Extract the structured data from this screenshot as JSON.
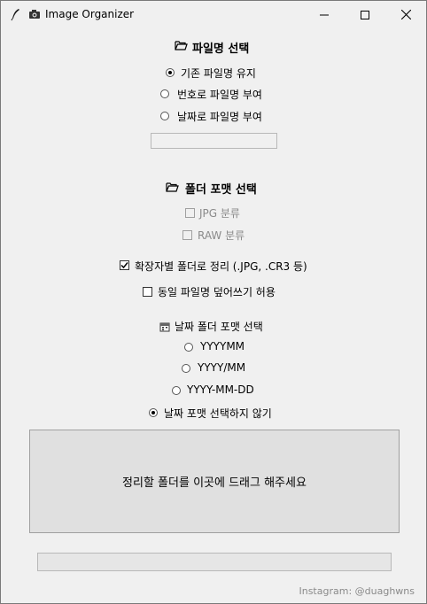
{
  "window": {
    "title": "Image Organizer",
    "icon": "feather-icon",
    "camera_icon": "camera-icon",
    "controls": [
      "minimize",
      "maximize",
      "close"
    ]
  },
  "filename_section": {
    "title": "파일명 선택",
    "icon": "folder-open-icon",
    "options": [
      {
        "label": "기존 파일명 유지",
        "selected": true
      },
      {
        "label": "번호로 파일명 부여",
        "selected": false
      },
      {
        "label": "날짜로 파일명 부여",
        "selected": false
      }
    ],
    "entry_value": ""
  },
  "folder_section": {
    "title": "폴더 포맷 선택",
    "icon": "folder-open-icon",
    "jpg_label": "JPG 분류",
    "raw_label": "RAW 분류",
    "ext_label": "확장자별 폴더로 정리 (.JPG, .CR3 등)",
    "ext_checked": true,
    "overwrite_label": "동일 파일명 덮어쓰기 허용",
    "overwrite_checked": false
  },
  "date_section": {
    "title": "날짜 폴더 포맷 선택",
    "icon": "calendar-icon",
    "options": [
      {
        "label": "YYYYMM",
        "selected": false
      },
      {
        "label": "YYYY/MM",
        "selected": false
      },
      {
        "label": "YYYY-MM-DD",
        "selected": false
      },
      {
        "label": "날짜 포맷 선택하지 않기",
        "selected": true
      }
    ]
  },
  "dropzone": {
    "text": "정리할 폴더를 이곳에 드래그 해주세요"
  },
  "progress": {
    "value": 0
  },
  "footer": {
    "text": "Instagram: @duaghwns"
  }
}
